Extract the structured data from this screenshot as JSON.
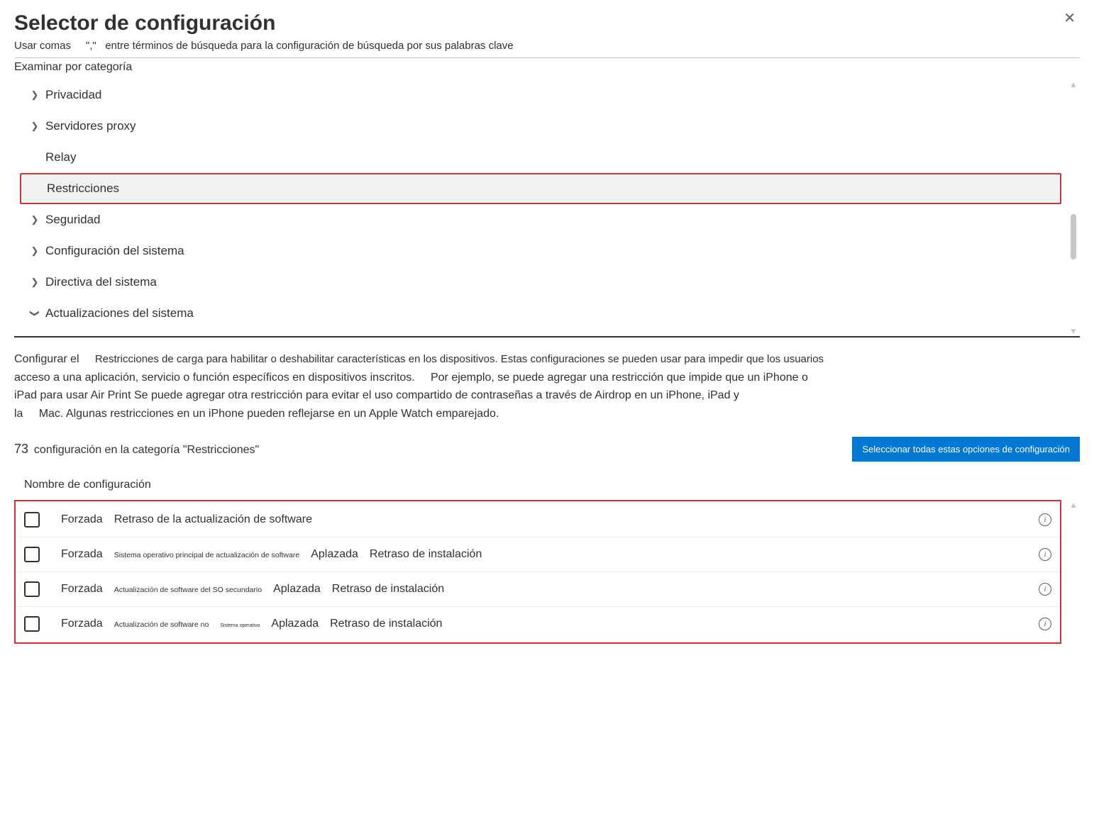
{
  "dialog": {
    "title": "Selector de configuración",
    "subtitle_a": "Usar comas",
    "subtitle_b": "\",\"",
    "subtitle_c": "entre términos de búsqueda para la configuración de búsqueda por sus palabras clave",
    "browse_label": "Examinar por categoría"
  },
  "categories": [
    {
      "label": "Privacidad",
      "chev": "right"
    },
    {
      "label": "Servidores proxy",
      "chev": "right"
    },
    {
      "label": "Relay",
      "chev": "none"
    },
    {
      "label": "Restricciones",
      "chev": "none",
      "highlighted": true
    },
    {
      "label": "Seguridad",
      "chev": "right"
    },
    {
      "label": "Configuración del sistema",
      "chev": "right"
    },
    {
      "label": "Directiva del sistema",
      "chev": "right"
    },
    {
      "label": "Actualizaciones del sistema",
      "chev": "down"
    }
  ],
  "description": {
    "p1a": "Configurar el",
    "p1b": "Restricciones de carga para habilitar o deshabilitar características en los dispositivos. Estas configuraciones se pueden usar para impedir que los usuarios",
    "p2a": "acceso a una aplicación, servicio o función específicos en dispositivos inscritos.",
    "p2b": "Por ejemplo, se puede agregar una restricción que impide que un iPhone o",
    "p3": "iPad para usar Air Print Se puede agregar otra restricción para evitar el uso compartido de contraseñas a través de Airdrop en un iPhone, iPad y",
    "p4a": "la",
    "p4b": "Mac. Algunas restricciones en un iPhone pueden reflejarse en un Apple Watch emparejado."
  },
  "count": {
    "number": "73",
    "text": "configuración en la categoría \"Restricciones\"",
    "button": "Seleccionar todas estas opciones de configuración"
  },
  "column_header": "Nombre de configuración",
  "settings": [
    {
      "forced": "Forzada",
      "p1": "Retraso de la actualización de software"
    },
    {
      "forced": "Forzada",
      "tiny": "Sistema operativo principal de actualización de software",
      "p2": "Aplazada",
      "p3": "Retraso de instalación"
    },
    {
      "forced": "Forzada",
      "tiny": "Actualización de software del SO secundario",
      "p2": "Aplazada",
      "p3": "Retraso de instalación"
    },
    {
      "forced": "Forzada",
      "tiny": "Actualización de software no",
      "micro": "Sistema operativo",
      "p2": "Aplazada",
      "p3": "Retraso de instalación"
    }
  ]
}
